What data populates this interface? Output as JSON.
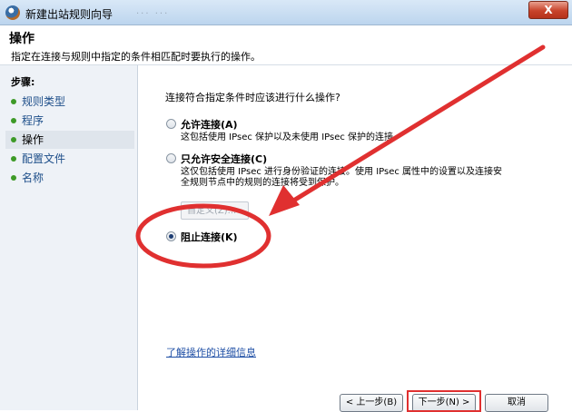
{
  "window": {
    "title": "新建出站规则向导",
    "close_label": "X",
    "background_ghost": "... ..."
  },
  "header": {
    "title": "操作",
    "description": "指定在连接与规则中指定的条件相匹配时要执行的操作。"
  },
  "sidebar": {
    "steps_heading": "步骤:",
    "items": [
      {
        "label": "规则类型"
      },
      {
        "label": "程序"
      },
      {
        "label": "操作"
      },
      {
        "label": "配置文件"
      },
      {
        "label": "名称"
      }
    ],
    "active_index": 2
  },
  "main": {
    "question": "连接符合指定条件时应该进行什么操作?",
    "options": [
      {
        "label": "允许连接(A)",
        "desc": [
          "这包括使用 IPsec 保护以及未使用 IPsec 保护的连接。"
        ],
        "checked": false
      },
      {
        "label": "只允许安全连接(C)",
        "desc": [
          "这仅包括使用 IPsec 进行身份验证的连接。使用 IPsec 属性中的设置以及连接安",
          "全规则节点中的规则的连接将受到保护。"
        ],
        "checked": false
      },
      {
        "label": "阻止连接(K)",
        "desc": [],
        "checked": true
      }
    ],
    "custom_button": "自定义(Z)...",
    "learn_link": "了解操作的详细信息",
    "buttons": {
      "back": "< 上一步(B)",
      "next": "下一步(N) >",
      "cancel": "取消"
    }
  },
  "colors": {
    "annotation": "#e03030",
    "link": "#1f4fa5",
    "step_bullet": "#3d9a27"
  }
}
